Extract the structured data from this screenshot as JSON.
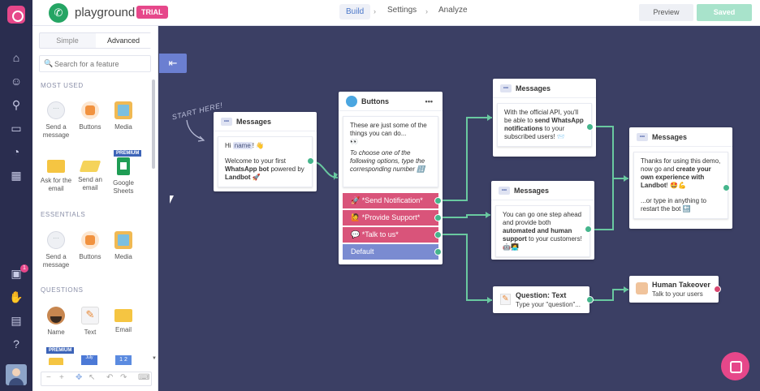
{
  "app": {
    "bot_name": "playground",
    "trial_badge": "TRIAL",
    "nav": [
      "Build",
      "Settings",
      "Analyze"
    ],
    "preview_label": "Preview",
    "saved_label": "Saved",
    "gift_badge_count": "1",
    "accent_color": "#e6478a"
  },
  "sidebar": {
    "tabs": [
      "Simple",
      "Advanced"
    ],
    "search_placeholder": "Search for a feature",
    "sections": {
      "most_used": "MOST USED",
      "essentials": "ESSENTIALS",
      "questions": "QUESTIONS"
    },
    "most_used": [
      "Send a message",
      "Buttons",
      "Media",
      "Ask for the email",
      "Send an email",
      "Google Sheets"
    ],
    "essentials": [
      "Send a message",
      "Buttons",
      "Media"
    ],
    "questions": [
      "Name",
      "Text",
      "Email"
    ],
    "premium_label": "PREMIUM",
    "calendar_label": "July",
    "number_label": "1 2"
  },
  "canvas": {
    "start_label": "START HERE!",
    "nodes": {
      "msg1": {
        "title": "Messages",
        "line1_pre": "Hi ",
        "line1_var": "name",
        "line1_post": "! 👋",
        "line2_pre": "Welcome to your first ",
        "line2_bold": "WhatsApp bot",
        "line2_mid": " powered by ",
        "line2_bold2": "Landbot",
        "line2_post": " 🚀"
      },
      "buttons": {
        "title": "Buttons",
        "menu": "•••",
        "text1": "These are just some of the things you can do...",
        "text1b": "👀",
        "text2": "To choose one of the following options, type the corresponding number 🔢",
        "options": [
          "🚀 *Send Notification*",
          "🙋 *Provide Support*",
          "💬 *Talk to us*",
          "Default"
        ]
      },
      "msg2": {
        "title": "Messages",
        "pre": "With the official API, you'll be able to ",
        "bold": "send WhatsApp notifications",
        "post": " to your subscribed users! 📨"
      },
      "msg3": {
        "title": "Messages",
        "pre": "You can go one step ahead and provide both ",
        "bold": "automated and human support",
        "post": " to your customers! 🤖👩‍💻"
      },
      "msg4": {
        "title": "Messages",
        "pre": "Thanks for using this demo, now go and ",
        "bold": "create your own experience with Landbot",
        "post": "! 🤩💪",
        "line2": "...or type in anything to restart the bot 🔙"
      },
      "question": {
        "title": "Question: Text",
        "text": "Type your \"question\"..."
      },
      "takeover": {
        "title": "Human Takeover",
        "text": "Talk to your users"
      }
    }
  },
  "icons": {
    "rail": [
      "home-icon",
      "bot-icon",
      "broadcast-icon",
      "chat-icon",
      "stats-icon",
      "apps-icon",
      "gift-icon",
      "handshake-icon",
      "marketplace-icon",
      "help-icon"
    ]
  }
}
